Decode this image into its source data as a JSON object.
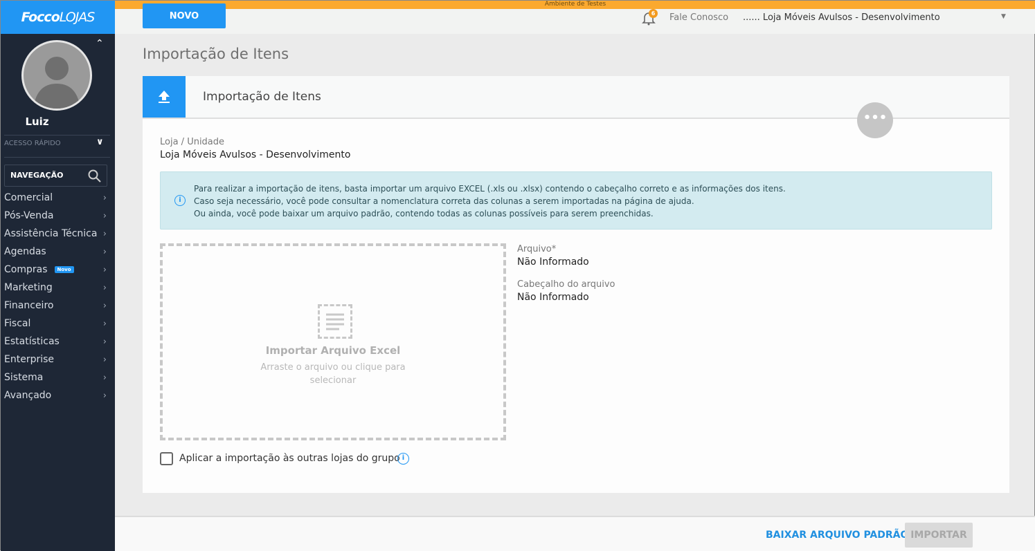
{
  "app": {
    "logo_bold": "Focco",
    "logo_light": "LOJAS",
    "env_banner": "Ambiente de Testes"
  },
  "sidebar": {
    "user_name": "Luiz",
    "quick_access": "ACESSO RÁPIDO",
    "nav_label": "NAVEGAÇÃO",
    "items": [
      {
        "label": "Comercial"
      },
      {
        "label": "Pós-Venda"
      },
      {
        "label": "Assistência Técnica"
      },
      {
        "label": "Agendas"
      },
      {
        "label": "Compras",
        "badge": "Novo"
      },
      {
        "label": "Marketing"
      },
      {
        "label": "Financeiro"
      },
      {
        "label": "Fiscal"
      },
      {
        "label": "Estatísticas"
      },
      {
        "label": "Enterprise"
      },
      {
        "label": "Sistema"
      },
      {
        "label": "Avançado"
      }
    ]
  },
  "header": {
    "new_button": "NOVO",
    "notifications": "6",
    "contact": "Fale Conosco",
    "store": "...... Loja Móveis Avulsos - Desenvolvimento"
  },
  "page": {
    "title": "Importação de Itens",
    "card_title": "Importação de Itens",
    "more": "•••",
    "store_label": "Loja / Unidade",
    "store_value": "Loja Móveis Avulsos - Desenvolvimento",
    "info_lines": [
      "Para realizar a importação de itens, basta importar um arquivo EXCEL (.xls ou .xlsx) contendo o cabeçalho correto e as informações dos itens.",
      "Caso seja necessário, você pode consultar a nomenclatura correta das colunas a serem importadas na página de ajuda.",
      "Ou ainda, você pode baixar um arquivo padrão, contendo todas as colunas possíveis para serem preenchidas."
    ],
    "drop_title": "Importar Arquivo Excel",
    "drop_hint": "Arraste o arquivo ou clique para selecionar",
    "file_label": "Arquivo*",
    "file_value": "Não Informado",
    "header_label": "Cabeçalho do arquivo",
    "header_value": "Não Informado",
    "apply_group": "Aplicar a importação às outras lojas do grupo"
  },
  "footer": {
    "download": "BAIXAR ARQUIVO PADRÃO",
    "import": "IMPORTAR"
  }
}
